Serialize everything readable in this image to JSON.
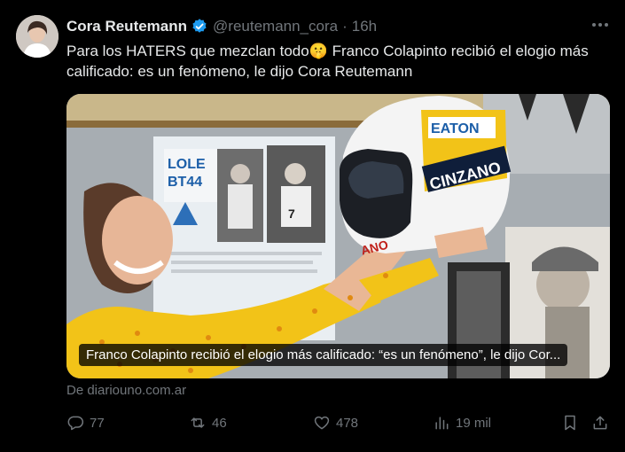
{
  "author": {
    "name": "Cora Reutemann",
    "handle": "@reutemann_cora",
    "separator": "·",
    "time": "16h"
  },
  "tweet_text": "Para los HATERS que mezclan todo🤫  Franco Colapinto recibió el elogio más calificado: es un fenómeno, le dijo Cora Reutemann",
  "media": {
    "caption": "Franco Colapinto recibió el elogio más calificado: “es un fenómeno”, le dijo Cor...",
    "poster_text_1": "LOLE",
    "poster_text_2": "BT44",
    "helmet_text_1": "EATON",
    "helmet_text_2": "CINZANO",
    "helmet_text_3": "ANO",
    "photo_number": "7"
  },
  "source": "De diariouno.com.ar",
  "actions": {
    "replies": "77",
    "reposts": "46",
    "likes": "478",
    "views": "19 mil"
  },
  "colors": {
    "background": "#000000",
    "text": "#e7e9ea",
    "muted": "#71767b",
    "verified": "#1d9bf0"
  }
}
